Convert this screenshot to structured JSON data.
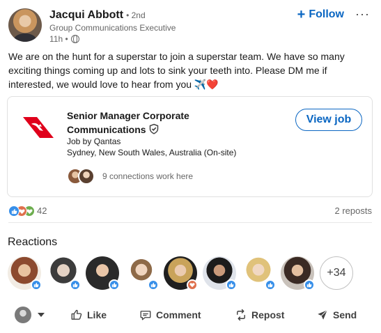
{
  "post": {
    "author_name": "Jacqui Abbott",
    "degree": "• 2nd",
    "headline": "Group Communications Executive",
    "time": "11h •",
    "follow_label": "Follow",
    "more_label": "···",
    "text": "We are on the hunt for a superstar to join a superstar team. We have so many exciting things coming up and lots to sink your teeth into. Please DM me if interested, we would love to hear from you ✈️❤️"
  },
  "job": {
    "title": "Senior Manager Corporate Communications",
    "company_line": "Job by Qantas",
    "location": "Sydney, New South Wales, Australia (On-site)",
    "view_label": "View job",
    "connections": "9 connections work here"
  },
  "social": {
    "reaction_count": "42",
    "reposts": "2 reposts"
  },
  "reactions": {
    "title": "Reactions",
    "more_label": "+34"
  },
  "actions": {
    "like": "Like",
    "comment": "Comment",
    "repost": "Repost",
    "send": "Send"
  },
  "colors": {
    "accent": "#0a66c2",
    "qantas_red": "#e0001b",
    "like_blue": "#378fe9",
    "love_red": "#df704d",
    "support_green": "#6dae4f"
  }
}
